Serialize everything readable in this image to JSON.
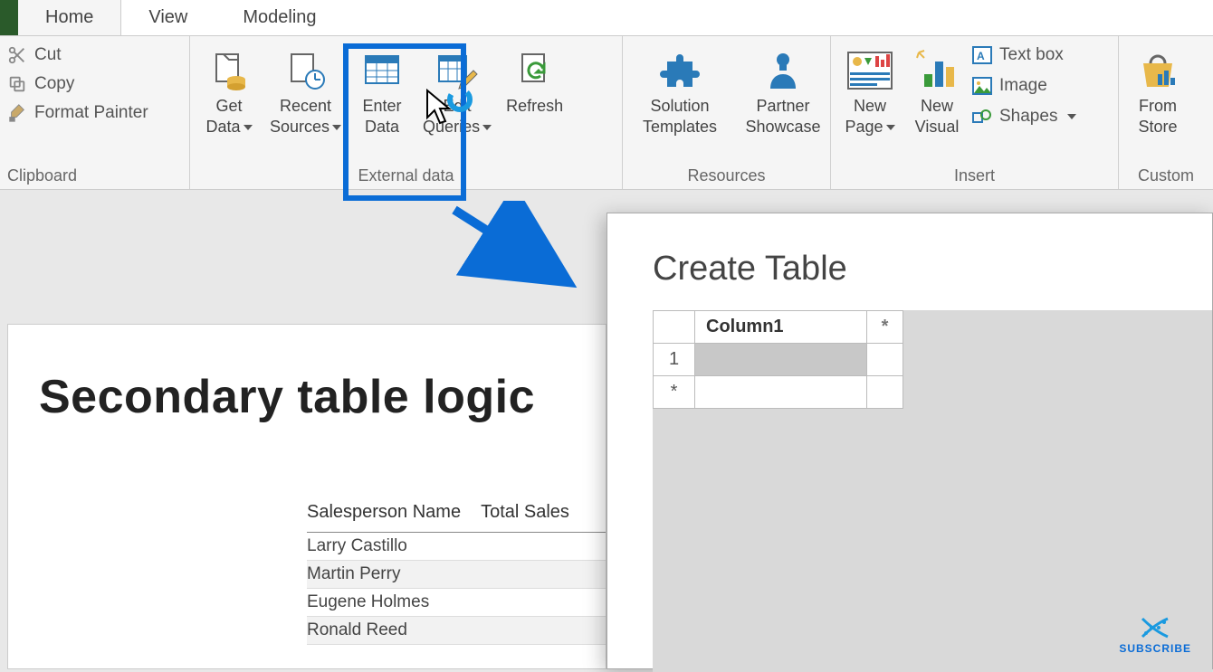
{
  "tabs": {
    "home": "Home",
    "view": "View",
    "modeling": "Modeling",
    "active": "Home"
  },
  "clipboard": {
    "cut": "Cut",
    "copy": "Copy",
    "format_painter": "Format Painter",
    "group": "Clipboard"
  },
  "external": {
    "get_data": "Get\nData",
    "recent_sources": "Recent\nSources",
    "enter_data": "Enter\nData",
    "edit_queries": "Edit\nQueries",
    "refresh": "Refresh",
    "group": "External data"
  },
  "resources": {
    "solution_templates": "Solution\nTemplates",
    "partner_showcase": "Partner\nShowcase",
    "group": "Resources"
  },
  "insert": {
    "new_page": "New\nPage",
    "new_visual": "New\nVisual",
    "text_box": "Text box",
    "image": "Image",
    "shapes": "Shapes",
    "group": "Insert"
  },
  "custom": {
    "from_store": "From\nStore",
    "group": "Custom "
  },
  "canvas": {
    "title": "Secondary table logic",
    "headers": [
      "Salesperson Name",
      "Total Sales"
    ],
    "rows": [
      "Larry Castillo",
      "Martin Perry",
      "Eugene Holmes",
      "Ronald Reed"
    ]
  },
  "dialog": {
    "title": "Create Table",
    "col1": "Column1",
    "addcol": "*",
    "row1": "1",
    "addrow": "*"
  },
  "subscribe": "SUBSCRIBE"
}
